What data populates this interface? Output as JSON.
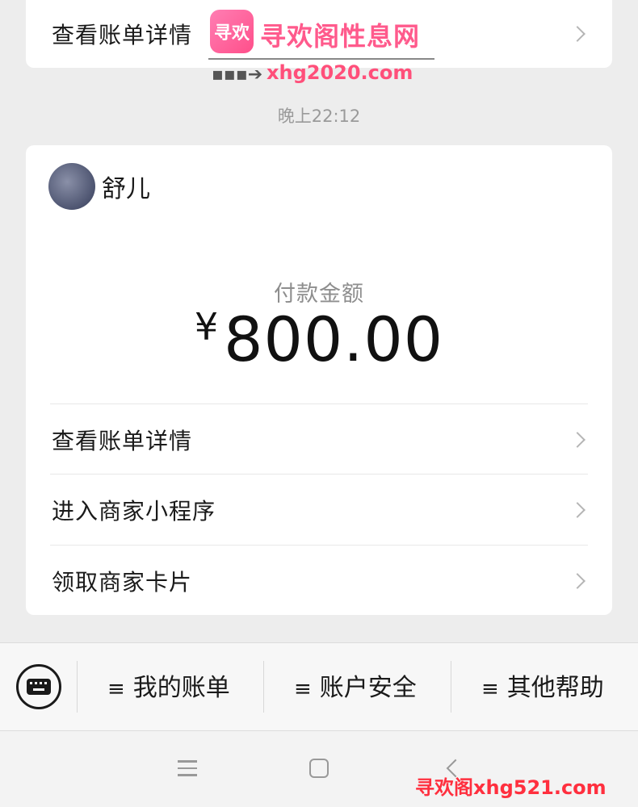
{
  "top_card": {
    "label": "查看账单详情"
  },
  "watermark_top": {
    "logo_text": "寻欢",
    "title": "寻欢阁性息网",
    "url": "xhg2020.com"
  },
  "timestamp": "晚上22:12",
  "payment_card": {
    "merchant_name": "舒儿",
    "amount_label": "付款金额",
    "currency": "¥",
    "amount": "800.00",
    "options": [
      {
        "label": "查看账单详情"
      },
      {
        "label": "进入商家小程序"
      },
      {
        "label": "领取商家卡片"
      }
    ]
  },
  "menu_bar": {
    "items": [
      {
        "label": "我的账单"
      },
      {
        "label": "账户安全"
      },
      {
        "label": "其他帮助"
      }
    ]
  },
  "watermark_bottom": "寻欢阁xhg521.com",
  "colors": {
    "background": "#ededed",
    "card": "#ffffff",
    "watermark_pink": "#ff5a8c",
    "watermark_red": "#ff2f3e"
  }
}
